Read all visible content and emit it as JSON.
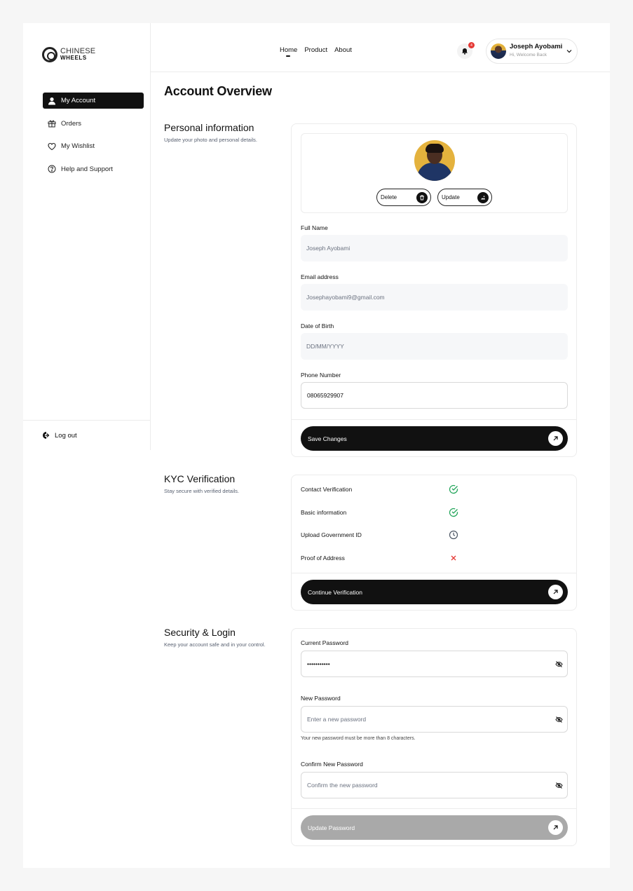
{
  "brand": {
    "line1": "CHINESE",
    "line2": "WHEELS"
  },
  "sidebar": {
    "items": [
      {
        "label": "My Account"
      },
      {
        "label": "Orders"
      },
      {
        "label": "My Wishlist"
      },
      {
        "label": "Help and Support"
      }
    ],
    "logout_label": "Log out"
  },
  "header": {
    "links": [
      {
        "label": "Home"
      },
      {
        "label": "Product"
      },
      {
        "label": "About"
      }
    ],
    "notification_count": "4",
    "user_name": "Joseph Ayobami",
    "user_greeting": "Hi, Welcome Back"
  },
  "page_title": "Account Overview",
  "personal": {
    "title": "Personal information",
    "subtitle": "Update your photo and personal details.",
    "delete_label": "Delete",
    "update_label": "Update",
    "full_name_label": "Full Name",
    "full_name_value": "Joseph Ayobami",
    "email_label": "Email address",
    "email_value": "Josephayobami9@gmail.com",
    "dob_label": "Date of Birth",
    "dob_placeholder": "DD/MM/YYYY",
    "phone_label": "Phone Number",
    "phone_value": "08065929907",
    "save_label": "Save Changes"
  },
  "kyc": {
    "title": "KYC Verification",
    "subtitle": "Stay secure with verified details.",
    "rows": [
      {
        "label": "Contact Verification",
        "status": "verified"
      },
      {
        "label": "Basic information",
        "status": "verified"
      },
      {
        "label": "Upload Government ID",
        "status": "pending"
      },
      {
        "label": "Proof of Address",
        "status": "failed"
      }
    ],
    "continue_label": "Continue Verification"
  },
  "security": {
    "title": "Security & Login",
    "subtitle": "Keep your account safe and in your control.",
    "current_label": "Current Password",
    "current_value": "•••••••••••",
    "new_label": "New Password",
    "new_placeholder": "Enter a new password",
    "new_hint": "Your new password must be more than 8 characters.",
    "confirm_label": "Confirm New Password",
    "confirm_placeholder": "Confirm the new password",
    "update_label": "Update Password"
  },
  "colors": {
    "accent": "#111111",
    "success": "#22a55a",
    "danger": "#e53935",
    "pending": "#4b5563",
    "disabled": "#a9a9a9"
  }
}
